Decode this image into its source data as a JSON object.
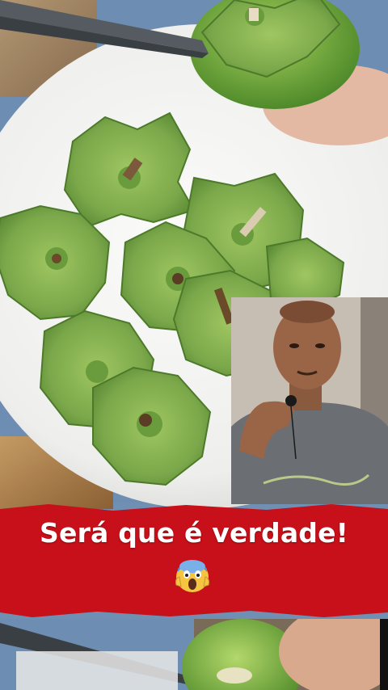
{
  "overlay": {
    "caption": "Será que é verdade!",
    "emoji_icon": "face-screaming-in-fear-icon"
  },
  "colors": {
    "banner_red": "#c8101a",
    "caption_text": "#ffffff",
    "leaf_green": "#7fae4a",
    "plate_white": "#f2f2f0"
  }
}
